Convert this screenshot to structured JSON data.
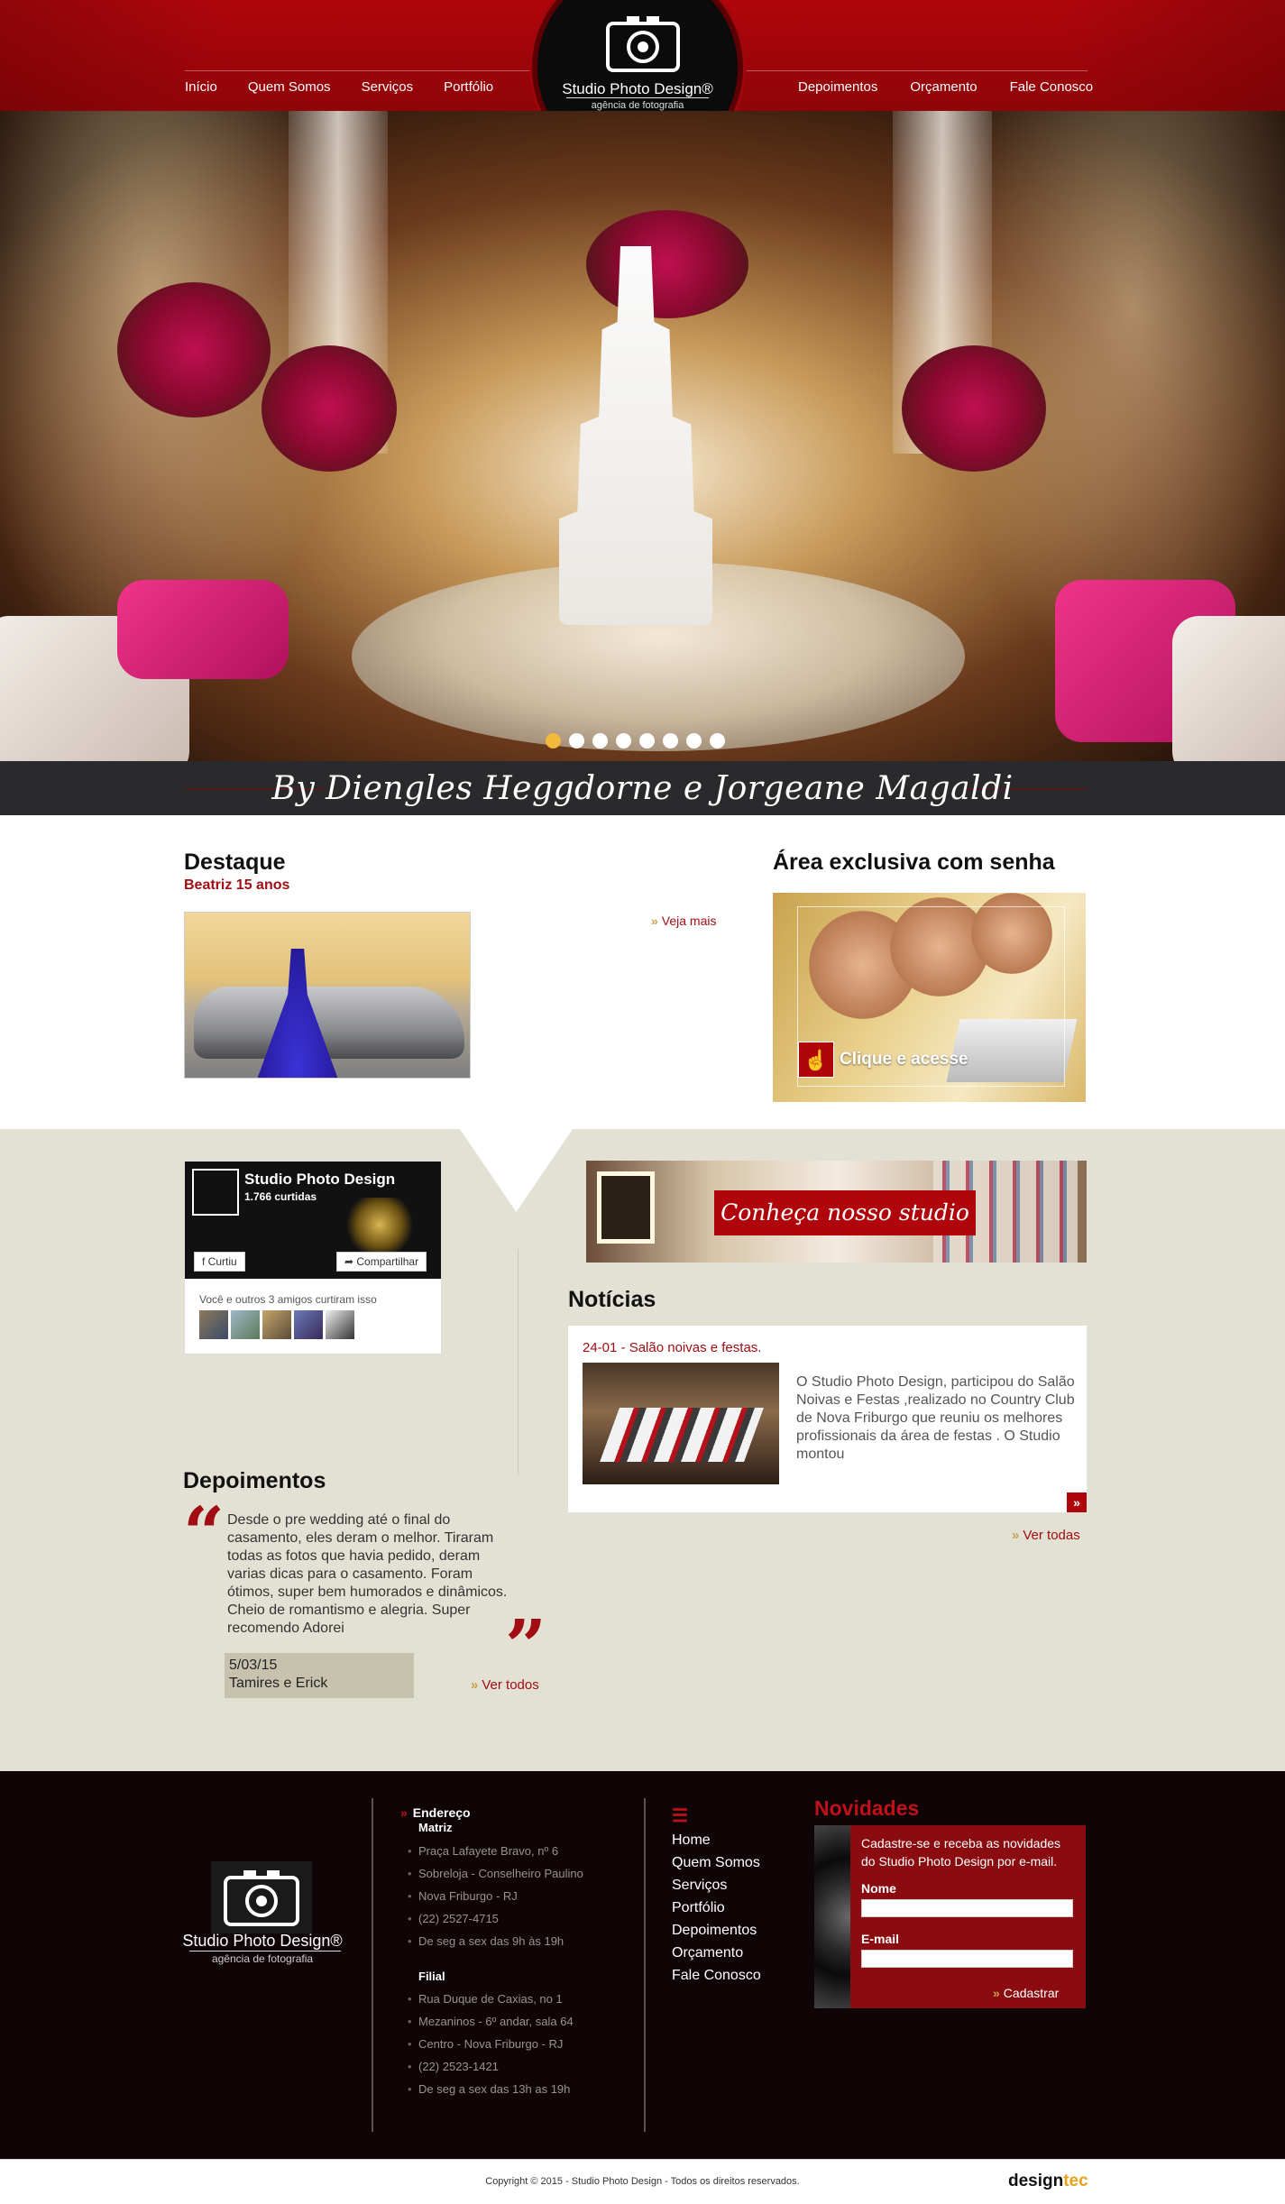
{
  "nav": {
    "left": [
      "Início",
      "Quem Somos",
      "Serviços",
      "Portfólio"
    ],
    "right": [
      "Depoimentos",
      "Orçamento",
      "Fale Conosco"
    ]
  },
  "logo": {
    "name": "Studio Photo Design®",
    "tagline": "agência de fotografia"
  },
  "hero": {
    "slide_count": 8,
    "active_slide": 1,
    "byline": "By Diengles Heggdorne e Jorgeane Magaldi"
  },
  "destaque": {
    "title": "Destaque",
    "subtitle": "Beatriz 15 anos",
    "more_label": "Veja mais"
  },
  "area": {
    "title": "Área exclusiva com senha",
    "cta_label": "Clique e acesse"
  },
  "facebook": {
    "page_name": "Studio Photo Design",
    "likes": "1.766 curtidas",
    "like_button": "Curtiu",
    "share_button": "Compartilhar",
    "friends_text": "Você e outros 3 amigos curtiram isso"
  },
  "studio_banner": {
    "label": "Conheça nosso studio"
  },
  "noticias": {
    "title": "Notícias",
    "item": {
      "date_title": "24-01 - Salão noivas e festas.",
      "text": "O Studio Photo Design, participou do Salão Noivas e Festas ,realizado no Country Club de Nova Friburgo  que reuniu os melhores profissionais da área de festas . O Studio montou"
    },
    "more_label": "Ver todas"
  },
  "depoimentos": {
    "title": "Depoimentos",
    "text": "Desde o pre wedding até o final do casamento, eles deram o melhor. Tiraram todas as fotos que havia pedido, deram varias dicas para o casamento. Foram ótimos, super bem humorados e dinâmicos. Cheio de romantismo e alegria. Super recomendo Adorei",
    "date": "5/03/15",
    "author": "Tamires e Erick",
    "more_label": "Ver todos"
  },
  "footer": {
    "logo_name": "Studio Photo Design®",
    "logo_tagline": "agência de fotografia",
    "address_heading": "Endereço",
    "matriz_label": "Matriz",
    "matriz_lines": [
      "Praça Lafayete Bravo, nº 6",
      "Sobreloja - Conselheiro Paulino",
      "Nova Friburgo - RJ",
      "(22) 2527-4715",
      "De seg a sex das 9h às 19h"
    ],
    "filial_label": "Filial",
    "filial_lines": [
      "Rua Duque de Caxias, no 1",
      "Mezaninos - 6º andar, sala 64",
      "Centro - Nova Friburgo - RJ",
      "(22) 2523-1421",
      "De seg a sex das 13h as 19h"
    ],
    "menu": [
      "Home",
      "Quem Somos",
      "Serviços",
      "Portfólio",
      "Depoimentos",
      "Orçamento",
      "Fale Conosco"
    ],
    "newsletter": {
      "title": "Novidades",
      "intro": "Cadastre-se e receba as novidades do Studio Photo Design por e-mail.",
      "name_label": "Nome",
      "email_label": "E-mail",
      "submit_label": "Cadastrar"
    }
  },
  "copyright": "Copyright © 2015 - Studio Photo Design - Todos os direitos reservados.",
  "credit": {
    "part1": "design",
    "part2": "tec"
  },
  "colors": {
    "brand_red": "#b0060b",
    "dark": "#0f0506",
    "beige": "#e3e1d4",
    "accent_gold": "#c9a24a"
  }
}
